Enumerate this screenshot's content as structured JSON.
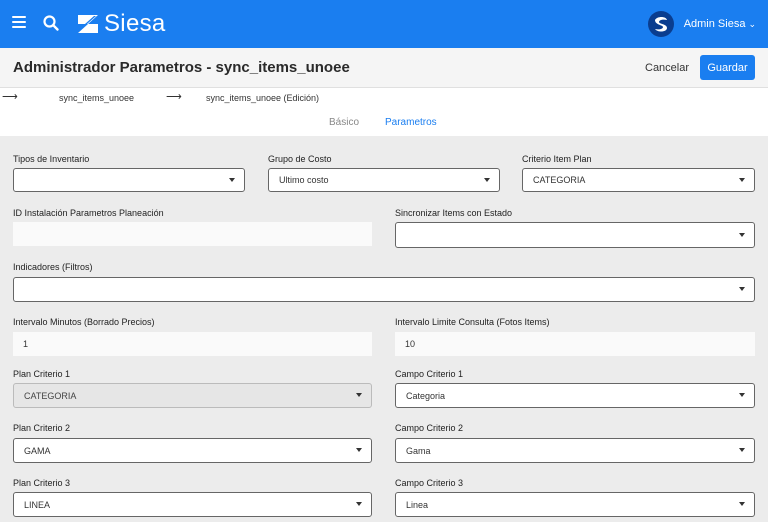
{
  "app": {
    "brand": "Siesa",
    "user_name": "Admin Siesa",
    "accent": "#1a7ef0"
  },
  "header": {
    "title": "Administrador Parametros - sync_items_unoee",
    "cancel_label": "Cancelar",
    "save_label": "Guardar"
  },
  "breadcrumb": {
    "item1": "sync_items_unoee",
    "item2": "sync_items_unoee (Edición)"
  },
  "tabs": {
    "basic": "Básico",
    "params": "Parametros",
    "active": "Parametros"
  },
  "form": {
    "tipos_inventario": {
      "label": "Tipos de Inventario",
      "value": ""
    },
    "grupo_costo": {
      "label": "Grupo de Costo",
      "value": "Ultimo costo"
    },
    "criterio_item_plan": {
      "label": "Criterio Item Plan",
      "value": "CATEGORIA"
    },
    "id_instalacion": {
      "label": "ID Instalación Parametros Planeación",
      "value": ""
    },
    "sincronizar_estado": {
      "label": "Sincronizar Items con Estado",
      "value": ""
    },
    "indicadores": {
      "label": "Indicadores (Filtros)",
      "value": ""
    },
    "intervalo_minutos": {
      "label": "Intervalo Minutos (Borrado Precios)",
      "value": "1"
    },
    "intervalo_limite": {
      "label": "Intervalo Limite Consulta (Fotos Items)",
      "value": "10"
    },
    "plan_criterio_1": {
      "label": "Plan Criterio 1",
      "value": "CATEGORIA"
    },
    "campo_criterio_1": {
      "label": "Campo Criterio 1",
      "value": "Categoria"
    },
    "plan_criterio_2": {
      "label": "Plan Criterio 2",
      "value": "GAMA"
    },
    "campo_criterio_2": {
      "label": "Campo Criterio 2",
      "value": "Gama"
    },
    "plan_criterio_3": {
      "label": "Plan Criterio 3",
      "value": "LINEA"
    },
    "campo_criterio_3": {
      "label": "Campo Criterio 3",
      "value": "Linea"
    }
  }
}
